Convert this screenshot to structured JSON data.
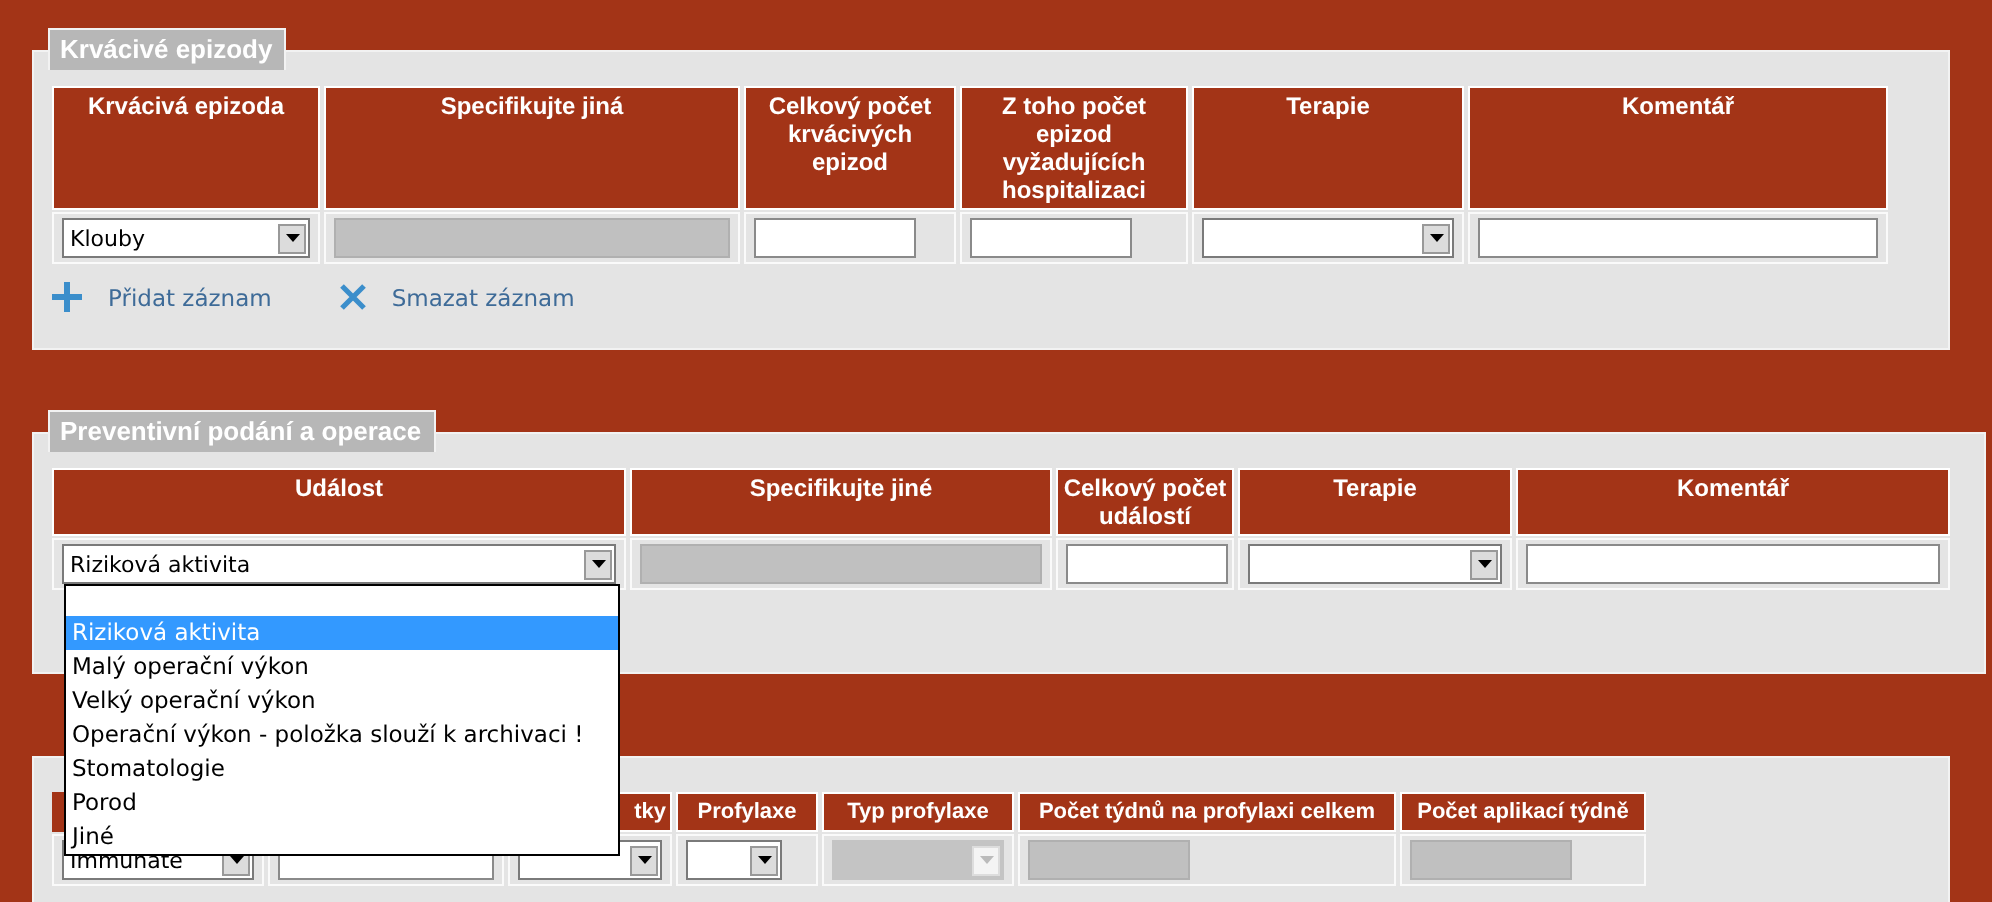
{
  "sections": [
    {
      "title": "Krvácivé epizody",
      "columns": [
        {
          "label": "Krvácivá epizoda"
        },
        {
          "label": "Specifikujte jiná"
        },
        {
          "label": "Celkový počet krvácivých epizod"
        },
        {
          "label": "Z toho počet epizod vyžadujících hospitalizaci"
        },
        {
          "label": "Terapie"
        },
        {
          "label": "Komentář"
        }
      ],
      "row": [
        {
          "kind": "select",
          "value": "Klouby"
        },
        {
          "kind": "disabled"
        },
        {
          "kind": "number"
        },
        {
          "kind": "number"
        },
        {
          "kind": "select"
        },
        {
          "kind": "text"
        }
      ],
      "actions": [
        {
          "kind": "add",
          "label": "Přidat záznam"
        },
        {
          "kind": "delete",
          "label": "Smazat záznam"
        }
      ]
    },
    {
      "title": "Preventivní podání a operace",
      "columns": [
        {
          "label": "Událost"
        },
        {
          "label": "Specifikujte jiné"
        },
        {
          "label": "Celkový počet událostí"
        },
        {
          "label": "Terapie"
        },
        {
          "label": "Komentář"
        }
      ],
      "row": [
        {
          "kind": "select",
          "value": "Riziková aktivita",
          "open": true
        },
        {
          "kind": "disabled"
        },
        {
          "kind": "number"
        },
        {
          "kind": "select"
        },
        {
          "kind": "text"
        }
      ]
    },
    {
      "columns": [
        {
          "kind": "covered"
        },
        {
          "kind": "covered"
        },
        {
          "label": "tky"
        },
        {
          "label": "Profylaxe"
        },
        {
          "label": "Typ profylaxe"
        },
        {
          "label": "Počet týdnů na profylaxi celkem"
        },
        {
          "label": "Počet aplikací týdně"
        }
      ],
      "row": [
        {
          "kind": "select",
          "value": "Immunate"
        },
        {
          "kind": "text"
        },
        {
          "kind": "select"
        },
        {
          "kind": "select"
        },
        {
          "kind": "disabled-select"
        },
        {
          "kind": "disabled-number"
        },
        {
          "kind": "disabled-number"
        }
      ]
    }
  ],
  "dropdown": {
    "options": [
      {
        "kind": "blank",
        "selected": false
      },
      {
        "label": "Riziková aktivita",
        "selected": true
      },
      {
        "label": "Malý operační výkon",
        "selected": false
      },
      {
        "label": "Velký operační výkon",
        "selected": false
      },
      {
        "label": "Operační výkon - položka slouží k archivaci !",
        "selected": false
      },
      {
        "label": "Stomatologie",
        "selected": false
      },
      {
        "label": "Porod",
        "selected": false
      },
      {
        "label": "Jiné",
        "selected": false
      }
    ]
  }
}
